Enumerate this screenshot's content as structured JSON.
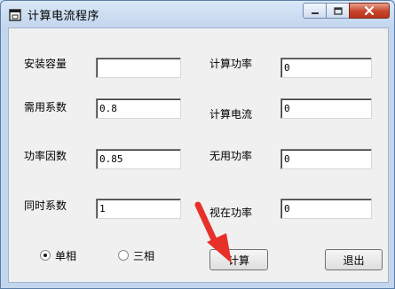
{
  "window": {
    "title": "计算电流程序",
    "icons": {
      "app": "app-window-icon",
      "minimize": "minimize-icon",
      "maximize": "maximize-icon",
      "close": "close-icon"
    }
  },
  "left_fields": [
    {
      "label": "安装容量",
      "value": ""
    },
    {
      "label": "需用系数",
      "value": "0.8"
    },
    {
      "label": "功率因数",
      "value": "0.85"
    },
    {
      "label": "同时系数",
      "value": "1"
    }
  ],
  "right_fields": [
    {
      "label": "计算功率",
      "value": "0"
    },
    {
      "label": "计算电流",
      "value": "0"
    },
    {
      "label": "无用功率",
      "value": "0"
    },
    {
      "label": "视在功率",
      "value": "0"
    }
  ],
  "phase": {
    "options": [
      {
        "label": "单相",
        "selected": true
      },
      {
        "label": "三相",
        "selected": false
      }
    ]
  },
  "buttons": {
    "calculate": "计算",
    "exit": "退出"
  },
  "colors": {
    "annotation_arrow": "#e8302a",
    "close_button": "#c7432a"
  }
}
